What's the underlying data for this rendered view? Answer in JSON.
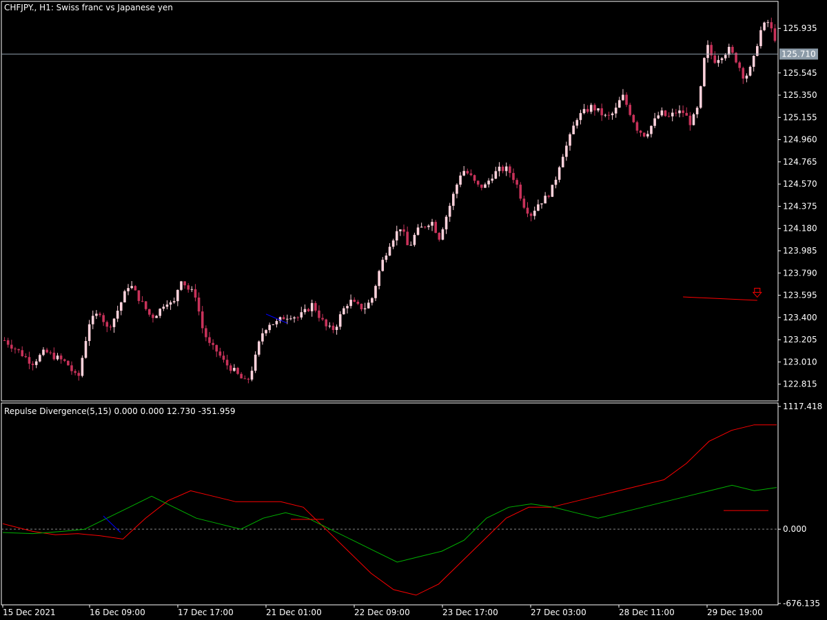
{
  "header": {
    "main_title": "CHFJPY., H1:  Swiss franc vs Japanese yen",
    "indicator_title": "Repulse Divergence(5,15) 0.000 0.000 12.730 -351.959"
  },
  "colors": {
    "background": "#000000",
    "frame": "#ffffff",
    "bull_candle": "#ffd2dc",
    "bear_candle": "#c8325a",
    "fast_line": "#ff0000",
    "slow_line": "#00b400",
    "bullish_div": "#0000ff",
    "bearish_div": "#ff0000",
    "price_tag_bg": "#8c9ba8"
  },
  "chart_data": [
    {
      "type": "candlestick",
      "price_ticks": [
        "125.935",
        "125.545",
        "125.350",
        "125.155",
        "124.960",
        "124.765",
        "124.570",
        "124.375",
        "124.180",
        "123.985",
        "123.790",
        "123.595",
        "123.400",
        "123.205",
        "123.010",
        "122.815"
      ],
      "current_price": "125.710",
      "ylim": [
        122.68,
        126.16
      ],
      "candle_count": 219,
      "keypoints": [
        [
          0,
          123.2
        ],
        [
          8,
          123.1
        ],
        [
          15,
          123.0
        ],
        [
          22,
          123.1
        ],
        [
          28,
          123.05
        ],
        [
          34,
          123.0
        ],
        [
          40,
          122.85
        ],
        [
          46,
          123.35
        ],
        [
          52,
          123.45
        ],
        [
          56,
          123.3
        ],
        [
          60,
          123.4
        ],
        [
          64,
          123.55
        ],
        [
          68,
          123.7
        ],
        [
          72,
          123.6
        ],
        [
          76,
          123.5
        ],
        [
          80,
          123.4
        ],
        [
          84,
          123.45
        ],
        [
          88,
          123.55
        ],
        [
          92,
          123.5
        ],
        [
          96,
          123.75
        ],
        [
          100,
          123.65
        ],
        [
          104,
          123.6
        ],
        [
          108,
          123.3
        ],
        [
          112,
          123.15
        ],
        [
          116,
          123.1
        ],
        [
          120,
          123.0
        ],
        [
          124,
          122.95
        ],
        [
          128,
          122.88
        ],
        [
          132,
          122.82
        ],
        [
          136,
          123.0
        ],
        [
          140,
          123.25
        ],
        [
          144,
          123.35
        ],
        [
          148,
          123.35
        ],
        [
          152,
          123.4
        ],
        [
          156,
          123.42
        ],
        [
          160,
          123.4
        ],
        [
          164,
          123.45
        ],
        [
          168,
          123.52
        ],
        [
          172,
          123.4
        ],
        [
          176,
          123.3
        ],
        [
          180,
          123.3
        ],
        [
          184,
          123.45
        ],
        [
          188,
          123.55
        ],
        [
          192,
          123.5
        ],
        [
          196,
          123.48
        ],
        [
          200,
          123.55
        ],
        [
          205,
          123.85
        ],
        [
          210,
          124.05
        ]
      ],
      "keypoints_note": "",
      "keypoints_b": [
        [
          0,
          124.1
        ],
        [
          3,
          124.2
        ],
        [
          6,
          124.0
        ],
        [
          9,
          124.15
        ],
        [
          12,
          124.2
        ],
        [
          15,
          124.25
        ],
        [
          18,
          124.1
        ],
        [
          21,
          124.3
        ],
        [
          24,
          124.5
        ],
        [
          27,
          124.7
        ],
        [
          30,
          124.65
        ],
        [
          33,
          124.55
        ],
        [
          36,
          124.55
        ],
        [
          39,
          124.65
        ],
        [
          42,
          124.7
        ],
        [
          45,
          124.7
        ],
        [
          48,
          124.6
        ],
        [
          51,
          124.4
        ],
        [
          54,
          124.3
        ],
        [
          57,
          124.4
        ],
        [
          60,
          124.45
        ],
        [
          63,
          124.55
        ],
        [
          66,
          124.8
        ],
        [
          69,
          124.95
        ],
        [
          72,
          125.15
        ],
        [
          75,
          125.2
        ],
        [
          78,
          125.25
        ],
        [
          81,
          125.2
        ],
        [
          84,
          125.15
        ],
        [
          87,
          125.2
        ],
        [
          90,
          125.35
        ],
        [
          93,
          125.2
        ],
        [
          96,
          125.05
        ],
        [
          99,
          125.0
        ],
        [
          102,
          125.1
        ],
        [
          105,
          125.2
        ],
        [
          108,
          125.15
        ],
        [
          111,
          125.2
        ],
        [
          114,
          125.2
        ],
        [
          117,
          125.1
        ],
        [
          120,
          125.25
        ],
        [
          123,
          125.8
        ],
        [
          126,
          125.65
        ],
        [
          129,
          125.7
        ],
        [
          132,
          125.75
        ],
        [
          135,
          125.65
        ],
        [
          138,
          125.5
        ],
        [
          141,
          125.6
        ],
        [
          144,
          125.9
        ],
        [
          147,
          126.0
        ],
        [
          150,
          125.85
        ]
      ],
      "x_labels": [
        "15 Dec 2021",
        "16 Dec 09:00",
        "17 Dec 17:00",
        "21 Dec 01:00",
        "22 Dec 09:00",
        "23 Dec 17:00",
        "27 Dec 03:00",
        "28 Dec 11:00",
        "29 Dec 19:00"
      ]
    },
    {
      "type": "line",
      "indicator_ticks": [
        "1117.418",
        "0.000",
        "-676.135"
      ],
      "ylim": [
        -676.135,
        1117.418
      ],
      "series": [
        {
          "color": "#ff0000",
          "points": [
            [
              0,
              50
            ],
            [
              8,
              -20
            ],
            [
              14,
              -50
            ],
            [
              20,
              -40
            ],
            [
              26,
              -60
            ],
            [
              32,
              -90
            ],
            [
              38,
              100
            ],
            [
              44,
              260
            ],
            [
              50,
              350
            ],
            [
              56,
              300
            ],
            [
              62,
              250
            ],
            [
              68,
              250
            ],
            [
              74,
              250
            ],
            [
              80,
              200
            ],
            [
              86,
              0
            ],
            [
              92,
              -200
            ],
            [
              98,
              -400
            ],
            [
              104,
              -550
            ],
            [
              110,
              -600
            ],
            [
              116,
              -500
            ],
            [
              122,
              -300
            ],
            [
              128,
              -100
            ],
            [
              134,
              100
            ],
            [
              140,
              200
            ],
            [
              146,
              200
            ],
            [
              152,
              250
            ],
            [
              158,
              300
            ],
            [
              164,
              350
            ],
            [
              170,
              400
            ],
            [
              176,
              450
            ],
            [
              182,
              600
            ],
            [
              188,
              800
            ],
            [
              194,
              900
            ],
            [
              200,
              950
            ],
            [
              206,
              950
            ]
          ]
        },
        {
          "color": "#00b400",
          "points": [
            [
              0,
              -30
            ],
            [
              8,
              -40
            ],
            [
              16,
              -20
            ],
            [
              22,
              0
            ],
            [
              28,
              100
            ],
            [
              34,
              200
            ],
            [
              40,
              300
            ],
            [
              46,
              200
            ],
            [
              52,
              100
            ],
            [
              58,
              50
            ],
            [
              64,
              0
            ],
            [
              70,
              100
            ],
            [
              76,
              150
            ],
            [
              82,
              100
            ],
            [
              88,
              0
            ],
            [
              94,
              -100
            ],
            [
              100,
              -200
            ],
            [
              106,
              -300
            ],
            [
              112,
              -250
            ],
            [
              118,
              -200
            ],
            [
              124,
              -100
            ],
            [
              130,
              100
            ],
            [
              136,
              200
            ],
            [
              142,
              230
            ],
            [
              148,
              200
            ],
            [
              154,
              150
            ],
            [
              160,
              100
            ],
            [
              166,
              150
            ],
            [
              172,
              200
            ],
            [
              178,
              250
            ],
            [
              184,
              300
            ],
            [
              190,
              350
            ],
            [
              196,
              400
            ],
            [
              202,
              350
            ],
            [
              208,
              380
            ]
          ]
        }
      ]
    }
  ]
}
